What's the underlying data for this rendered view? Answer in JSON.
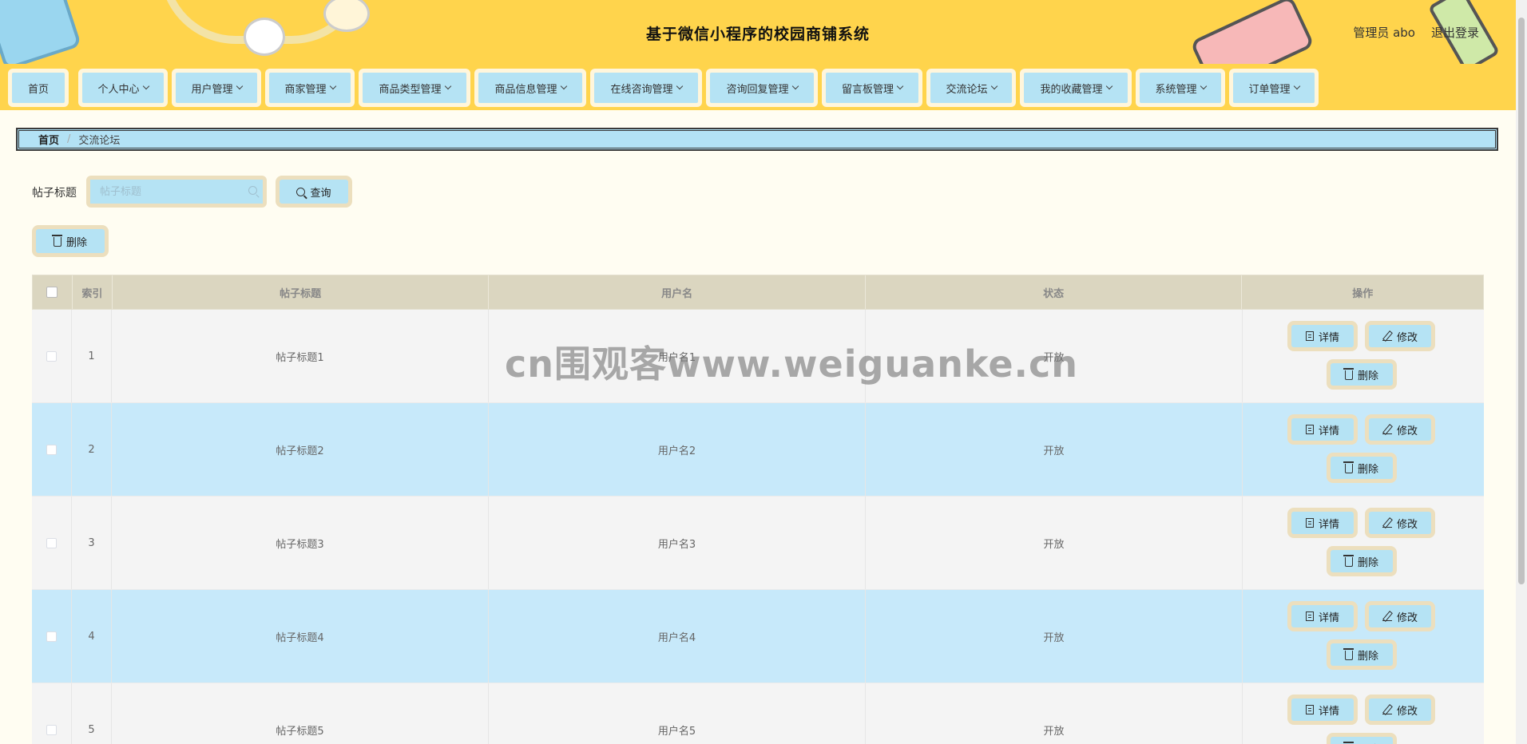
{
  "header": {
    "title": "基于微信小程序的校园商铺系统",
    "user_label": "管理员 abo",
    "logout_label": "退出登录"
  },
  "nav": {
    "items": [
      {
        "label": "首页",
        "has_dropdown": false
      },
      {
        "label": "个人中心",
        "has_dropdown": true
      },
      {
        "label": "用户管理",
        "has_dropdown": true
      },
      {
        "label": "商家管理",
        "has_dropdown": true
      },
      {
        "label": "商品类型管理",
        "has_dropdown": true
      },
      {
        "label": "商品信息管理",
        "has_dropdown": true
      },
      {
        "label": "在线咨询管理",
        "has_dropdown": true
      },
      {
        "label": "咨询回复管理",
        "has_dropdown": true
      },
      {
        "label": "留言板管理",
        "has_dropdown": true
      },
      {
        "label": "交流论坛",
        "has_dropdown": true
      },
      {
        "label": "我的收藏管理",
        "has_dropdown": true
      },
      {
        "label": "系统管理",
        "has_dropdown": true
      },
      {
        "label": "订单管理",
        "has_dropdown": true
      }
    ]
  },
  "breadcrumb": {
    "home": "首页",
    "separator": "/",
    "current": "交流论坛"
  },
  "search": {
    "label": "帖子标题",
    "placeholder": "帖子标题",
    "value": "",
    "button_label": "查询"
  },
  "toolbar": {
    "delete_label": "删除"
  },
  "table": {
    "columns": [
      "索引",
      "帖子标题",
      "用户名",
      "状态",
      "操作"
    ],
    "rows": [
      {
        "index": "1",
        "title": "帖子标题1",
        "username": "用户名1",
        "status": "开放"
      },
      {
        "index": "2",
        "title": "帖子标题2",
        "username": "用户名2",
        "status": "开放"
      },
      {
        "index": "3",
        "title": "帖子标题3",
        "username": "用户名3",
        "status": "开放"
      },
      {
        "index": "4",
        "title": "帖子标题4",
        "username": "用户名4",
        "status": "开放"
      },
      {
        "index": "5",
        "title": "帖子标题5",
        "username": "用户名5",
        "status": "开放"
      }
    ],
    "actions": {
      "detail": "详情",
      "edit": "修改",
      "delete": "删除"
    }
  },
  "watermark": "cn围观客www.weiguanke.cn",
  "colors": {
    "header_bg": "#ffd44c",
    "button_bg": "#b5e3f4",
    "button_frame": "#ecdfbe",
    "row_alt": "#c7e9fa",
    "page_bg": "#fffdf2"
  }
}
